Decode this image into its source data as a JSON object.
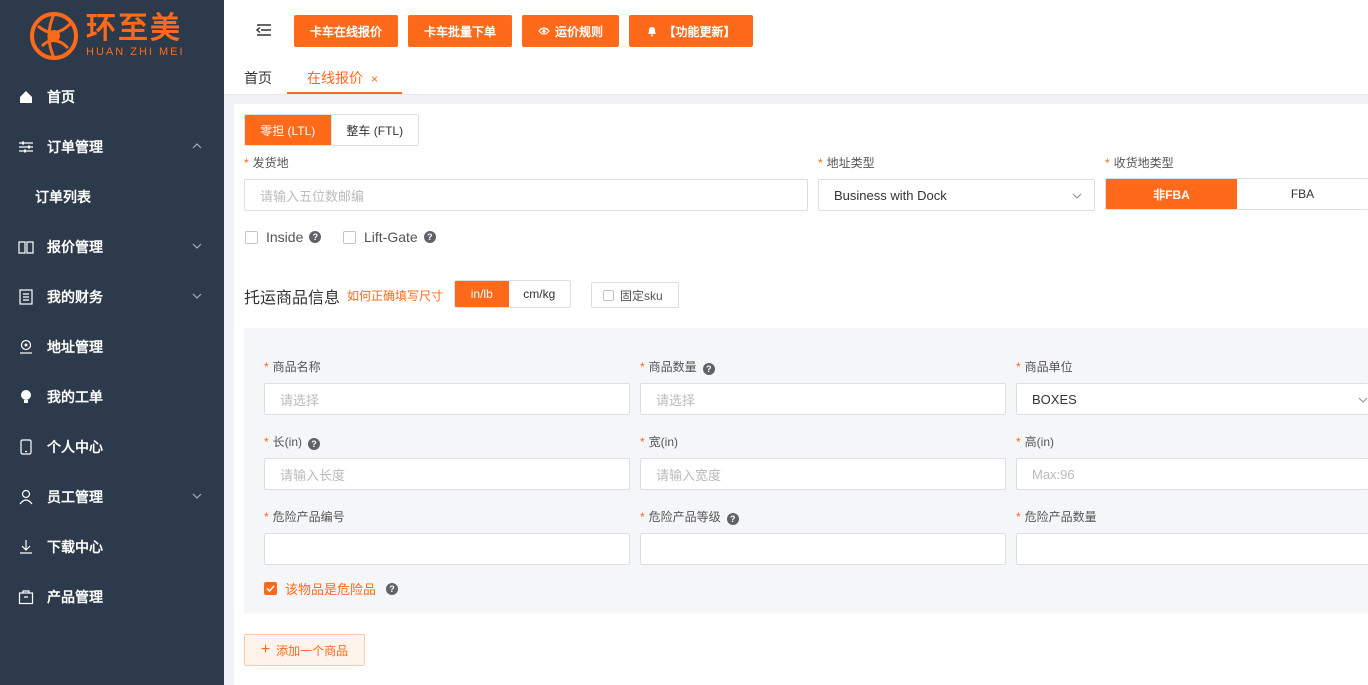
{
  "brand": {
    "name_cn": "环至美",
    "name_en": "HUAN ZHI MEI",
    "color": "#ff6a1a"
  },
  "sidebar": {
    "items": [
      {
        "label": "首页",
        "icon": "home-icon"
      },
      {
        "label": "订单管理",
        "icon": "sliders-icon",
        "expanded": true
      },
      {
        "label": "订单列表",
        "sub": true
      },
      {
        "label": "报价管理",
        "icon": "book-icon"
      },
      {
        "label": "我的财务",
        "icon": "document-icon"
      },
      {
        "label": "地址管理",
        "icon": "map-pin-icon"
      },
      {
        "label": "我的工单",
        "icon": "bulb-icon"
      },
      {
        "label": "个人中心",
        "icon": "phone-icon"
      },
      {
        "label": "员工管理",
        "icon": "user-icon"
      },
      {
        "label": "下载中心",
        "icon": "download-icon"
      },
      {
        "label": "产品管理",
        "icon": "package-icon"
      }
    ]
  },
  "header": {
    "buttons": [
      "卡车在线报价",
      "卡车批量下单",
      "运价规则",
      "【功能更新】"
    ]
  },
  "tabs": {
    "home": "首页",
    "active": "在线报价",
    "close": "×"
  },
  "form": {
    "mode_tabs": [
      "零担 (LTL)",
      "整车 (FTL)"
    ],
    "origin_label": "发货地",
    "origin_placeholder": "请输入五位数邮编",
    "address_type_label": "地址类型",
    "address_type_value": "Business with Dock",
    "dest_type_label": "收货地类型",
    "dest_type_options": [
      "非FBA",
      "FBA"
    ],
    "inside_label": "Inside",
    "liftgate_label": "Lift-Gate",
    "goods_title": "托运商品信息",
    "goods_help_link": "如何正确填写尺寸",
    "unit_options": [
      "in/lb",
      "cm/kg"
    ],
    "fixed_sku_label": "固定sku",
    "fields": {
      "name_label": "商品名称",
      "name_placeholder": "请选择",
      "qty_label": "商品数量",
      "qty_placeholder": "请选择",
      "unit_label": "商品单位",
      "unit_value": "BOXES",
      "length_label": "长(in)",
      "length_placeholder": "请输入长度",
      "width_label": "宽(in)",
      "width_placeholder": "请输入宽度",
      "height_label": "高(in)",
      "height_placeholder": "Max:96",
      "hazmat_no_label": "危险产品编号",
      "hazmat_level_label": "危险产品等级",
      "hazmat_qty_label": "危险产品数量",
      "hazmat_check_label": "该物品是危险品"
    },
    "add_goods_label": "添加一个商品",
    "required_mark": "*"
  }
}
